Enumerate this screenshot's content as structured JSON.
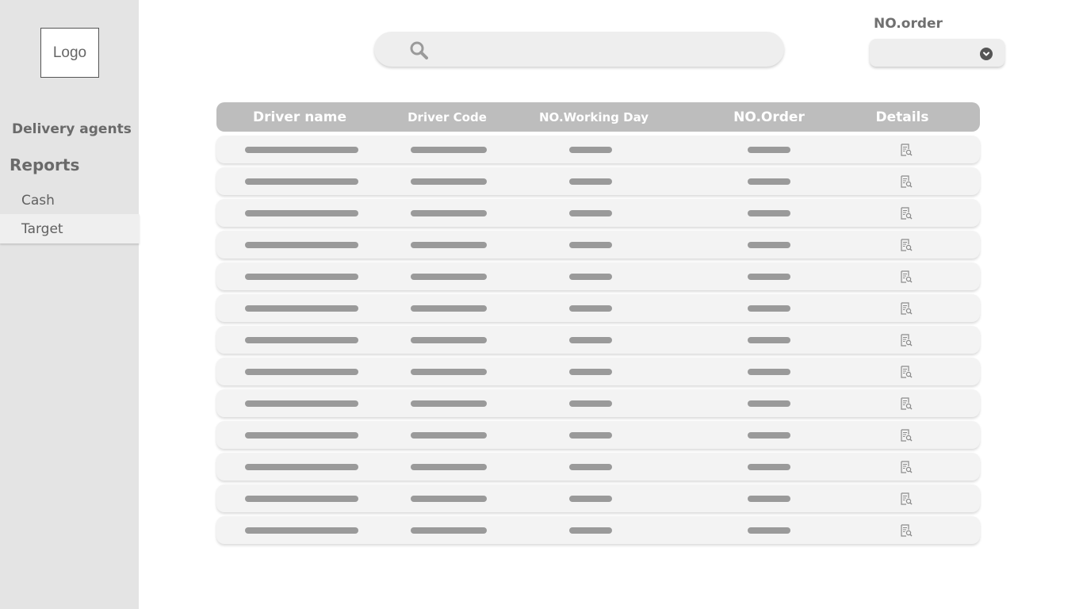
{
  "sidebar": {
    "logo": "Logo",
    "section": "Delivery agents",
    "reports": "Reports",
    "items": [
      {
        "label": "Cash",
        "active": false
      },
      {
        "label": "Target",
        "active": true
      }
    ]
  },
  "search": {
    "placeholder": "",
    "icon": "search-icon"
  },
  "order_filter": {
    "label": "NO.order",
    "selected": "",
    "icon": "chevron-down-icon"
  },
  "table": {
    "headers": [
      "Driver name",
      "Driver Code",
      "NO.Working Day",
      "NO.Order",
      "Details"
    ],
    "row_count": 13,
    "row_icon": "document-search-icon"
  },
  "colors": {
    "sidebar_bg": "#e4e4e4",
    "header_bg": "#bdbdbd",
    "row_bg": "#f3f3f3",
    "placeholder_bar": "#9a9a9a"
  }
}
